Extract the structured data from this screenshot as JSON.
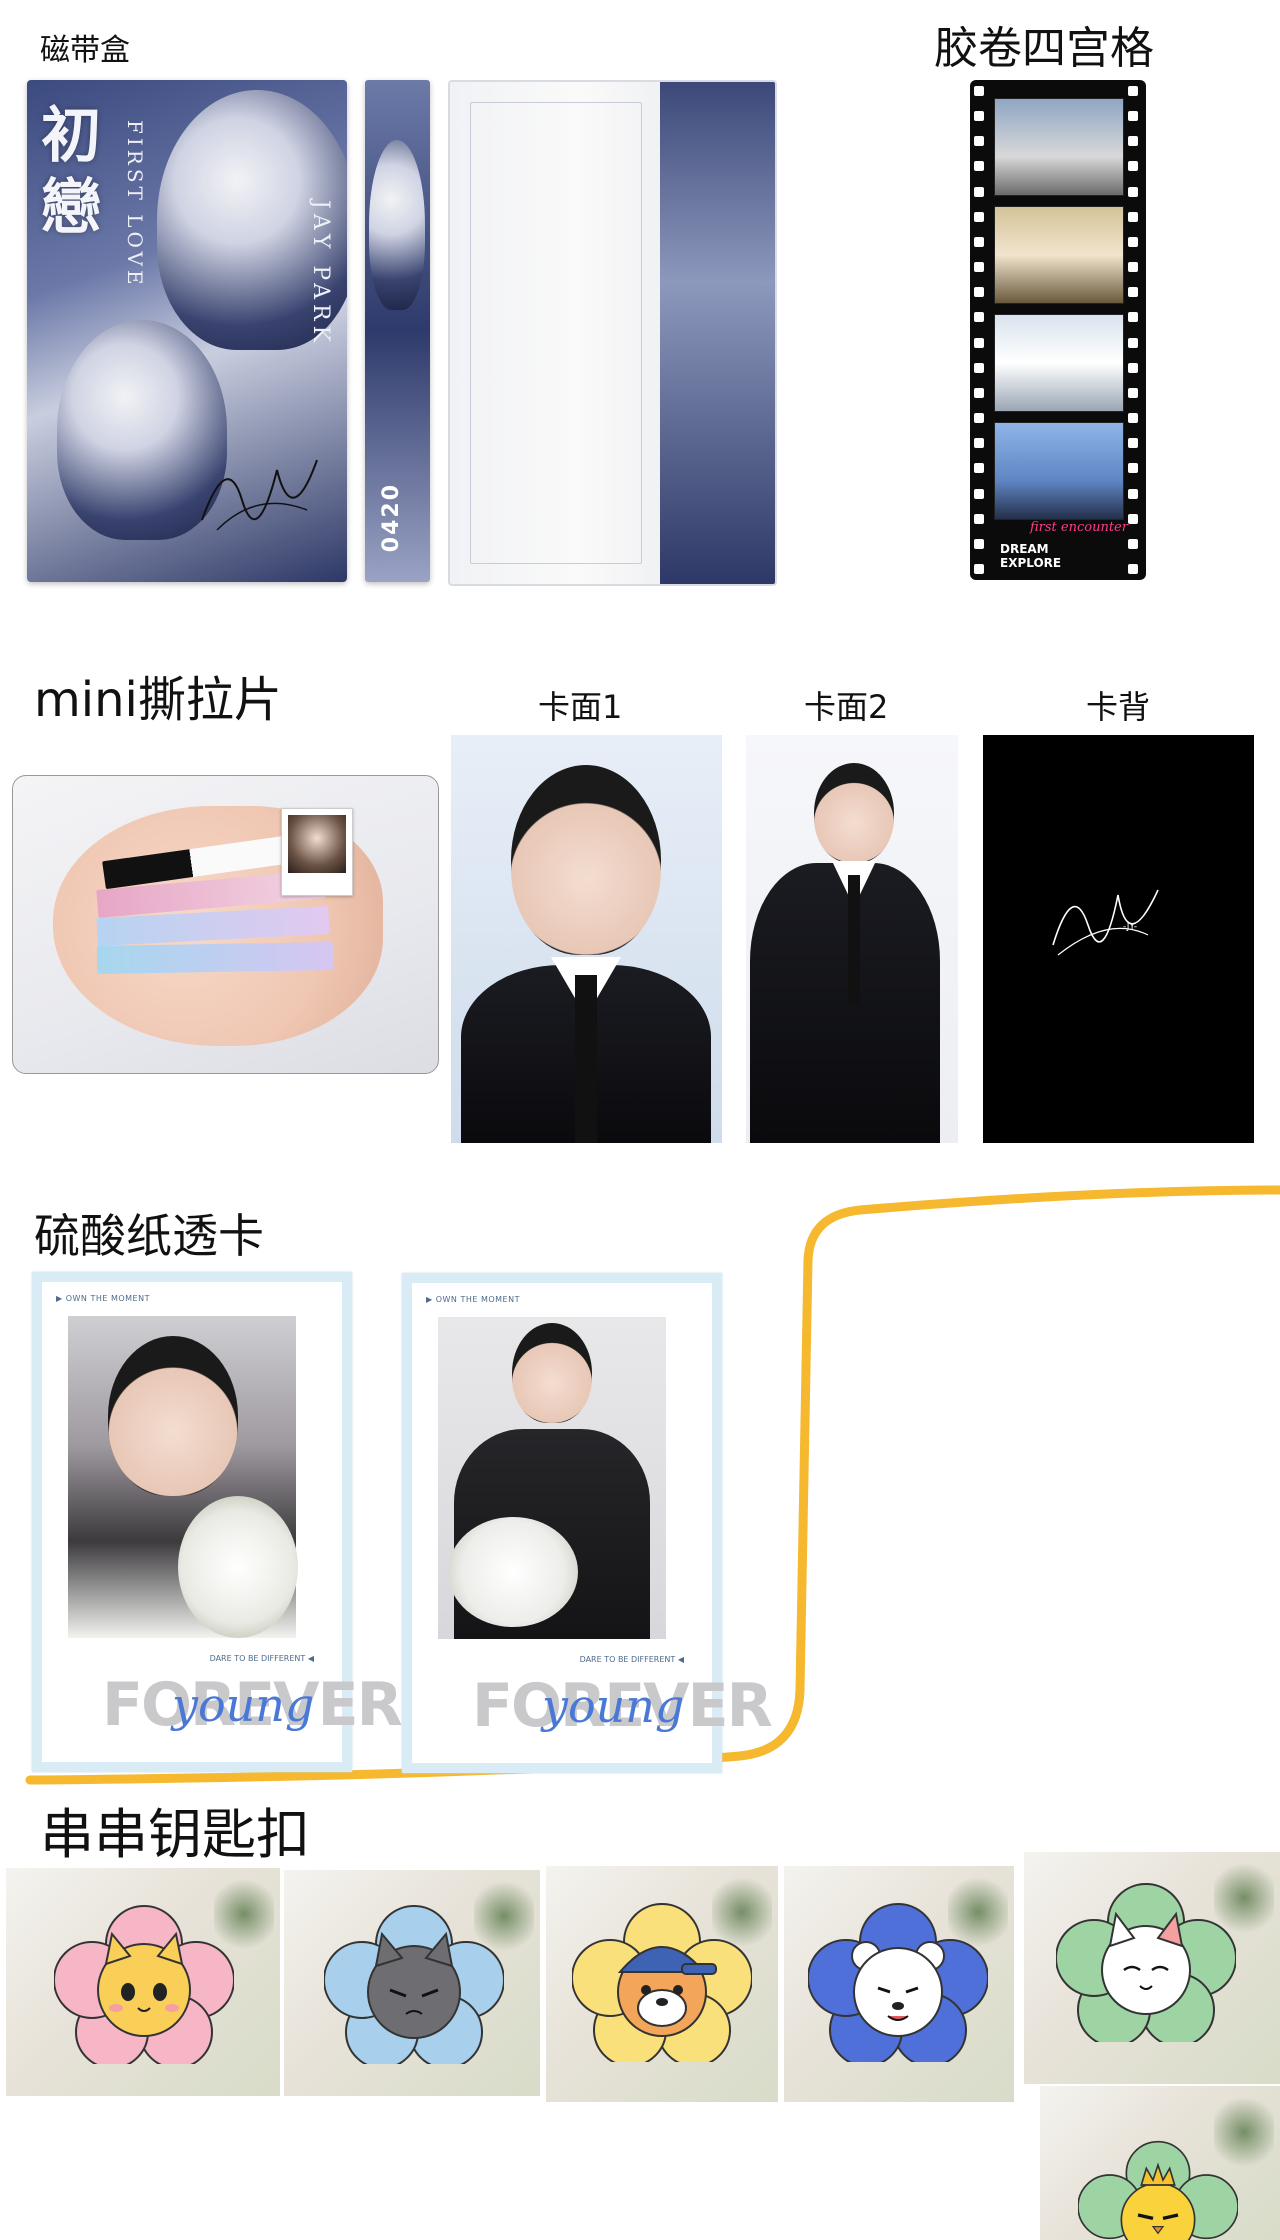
{
  "sections": {
    "cassette": {
      "label": "磁带盒",
      "title_cn": "初戀",
      "title_en": "FIRST LOVE",
      "artist": "JAY PARK",
      "spine": "0420"
    },
    "film": {
      "label": "胶卷四宫格",
      "script": "first encounter",
      "caption_1": "DREAM",
      "caption_2": "EXPLORE"
    },
    "mini": {
      "label": "mini撕拉片"
    },
    "card_face_1": {
      "label": "卡面1"
    },
    "card_face_2": {
      "label": "卡面2"
    },
    "card_back": {
      "label": "卡背",
      "back_text": "-JY-"
    },
    "trans": {
      "label": "硫酸纸透卡",
      "owm": "OWN THE MOMENT",
      "dare": "DARE TO BE DIFFERENT",
      "forever": "FOREVER",
      "young": "young"
    },
    "keychain": {
      "label": "串串钥匙扣"
    }
  },
  "colors": {
    "accent_yellow": "#f5b82e",
    "trans_border": "#d9ecf6",
    "young_blue": "#4a78d6"
  },
  "icons": [
    "cat-orange-icon",
    "cat-gray-icon",
    "dog-cap-icon",
    "bear-white-icon",
    "cat-green-icon",
    "chick-crown-icon"
  ]
}
